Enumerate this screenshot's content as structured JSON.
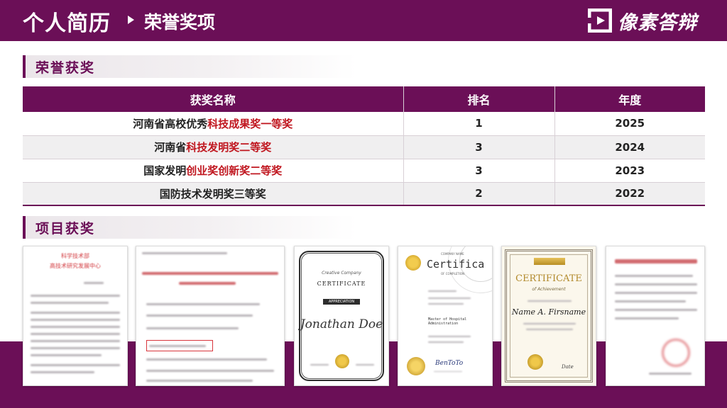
{
  "header": {
    "title": "个人简历",
    "subtitle": "荣誉奖项",
    "logo_text": "像素答辩"
  },
  "sections": {
    "honors": "荣誉获奖",
    "projects": "项目获奖"
  },
  "table": {
    "headers": [
      "获奖名称",
      "排名",
      "年度"
    ],
    "rows": [
      {
        "name_plain": "河南省高校优秀",
        "name_highlight": "科技成果奖一等奖",
        "rank": "1",
        "year": "2025"
      },
      {
        "name_plain": "河南省",
        "name_highlight": "科技发明奖二等奖",
        "rank": "3",
        "year": "2024"
      },
      {
        "name_plain": "国家发明",
        "name_highlight": "创业奖创新奖二等奖",
        "rank": "3",
        "year": "2023"
      },
      {
        "name_plain": "国防技术发明奖三等奖",
        "name_highlight": "",
        "rank": "2",
        "year": "2022"
      }
    ]
  },
  "certificates": {
    "cert1": {
      "line1": "科学技术部",
      "line2": "高技术研究发展中心"
    },
    "cert3": {
      "script": "Creative Company",
      "title": "CERTIFICATE",
      "ribbon": "APPRECIATION",
      "name": "Jonathan Doe"
    },
    "cert4": {
      "company": "COMPANY NAME",
      "title": "Certifica",
      "sub": "OF COMPLETION",
      "degree": "Master of Hospital Administration",
      "sign": "BenToTo"
    },
    "cert5": {
      "title": "CERTIFICATE",
      "sub": "of Achievement",
      "name": "Name A. Firsname",
      "sign": "Date"
    }
  },
  "colors": {
    "brand": "#6b0f57",
    "highlight": "#c0161f"
  }
}
